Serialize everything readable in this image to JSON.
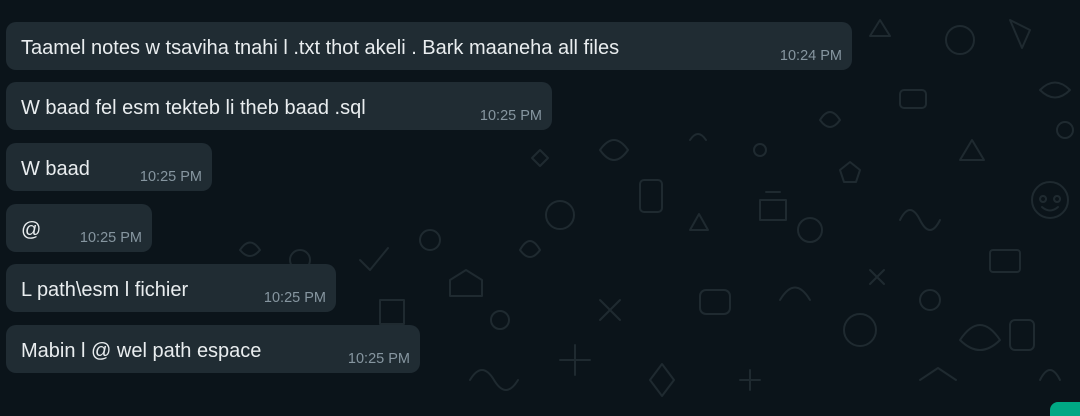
{
  "chat": {
    "messages": [
      {
        "text": "Taamel notes w tsaviha tnahi l .txt thot akeli . Bark maaneha all files",
        "time": "10:24 PM"
      },
      {
        "text": "W baad fel esm tekteb li theb baad .sql",
        "time": "10:25 PM"
      },
      {
        "text": "W baad",
        "time": "10:25 PM"
      },
      {
        "text": "@",
        "time": "10:25 PM"
      },
      {
        "text": "L path\\esm l fichier",
        "time": "10:25 PM"
      },
      {
        "text": "Mabin l @ wel path espace",
        "time": "10:25 PM"
      }
    ]
  },
  "colors": {
    "background": "#0b141a",
    "bubble": "#202c33",
    "text": "#e9edef",
    "timestamp": "#8696a0",
    "accent": "#00a884"
  }
}
